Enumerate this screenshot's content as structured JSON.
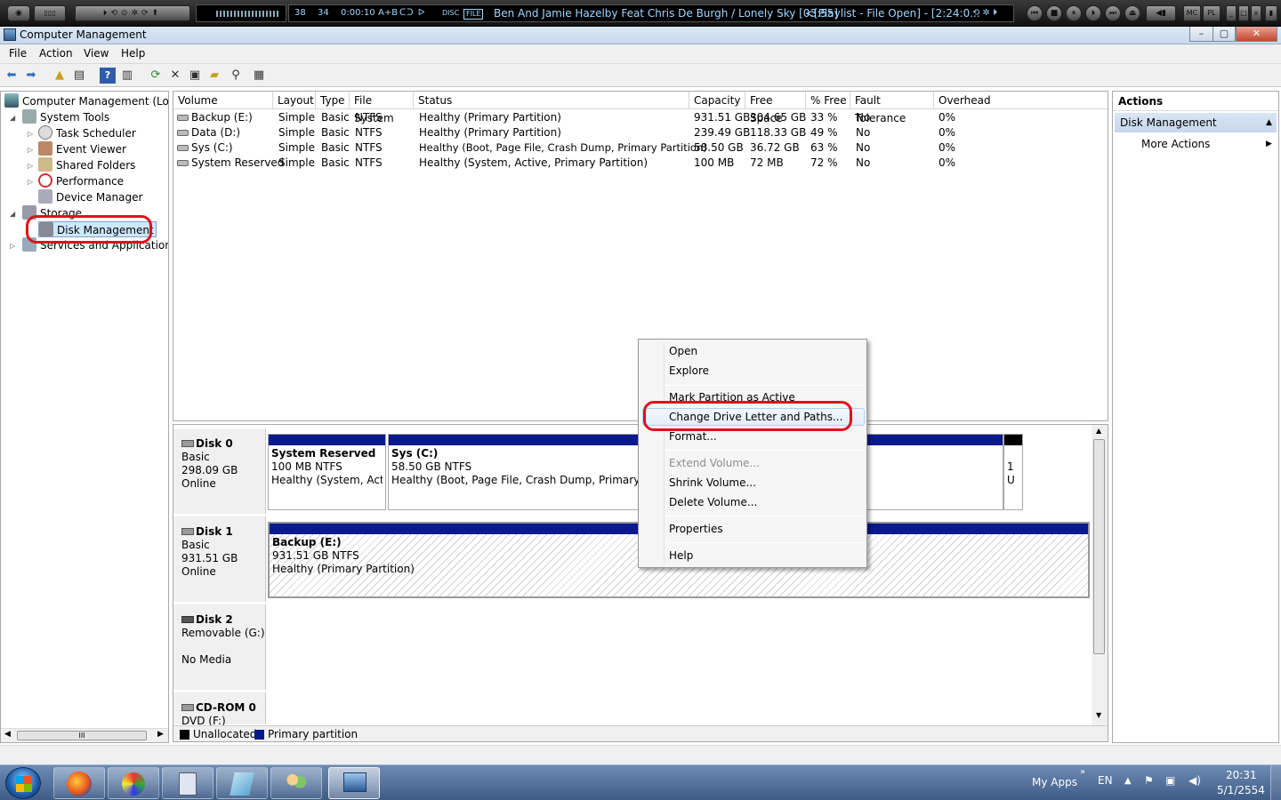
{
  "player": {
    "time_a": "38",
    "time_b": "34",
    "elapsed": "0:00:10",
    "mode_a": "A+B",
    "disc": "DISC",
    "file": "FILE",
    "now_playing": "Ben And Jamie Hazelby Feat Chris De Burgh / Lonely Sky  [03:55]",
    "playlist_status": "<[Playlist - File Open] - [2:24:0...",
    "btn_mc": "MC",
    "btn_pl": "PL"
  },
  "window": {
    "title": "Computer Management",
    "minimize": "–",
    "maximize": "▢",
    "close": "✕"
  },
  "menu": [
    "File",
    "Action",
    "View",
    "Help"
  ],
  "tree": {
    "root": "Computer Management (Local",
    "system_tools": "System Tools",
    "task_scheduler": "Task Scheduler",
    "event_viewer": "Event Viewer",
    "shared_folders": "Shared Folders",
    "performance": "Performance",
    "device_manager": "Device Manager",
    "storage": "Storage",
    "disk_management": "Disk Management",
    "services": "Services and Applications",
    "hscroll_grip": "III"
  },
  "volumes": {
    "headers": [
      "Volume",
      "Layout",
      "Type",
      "File System",
      "Status",
      "Capacity",
      "Free Space",
      "% Free",
      "Fault Tolerance",
      "Overhead"
    ],
    "rows": [
      [
        "Backup (E:)",
        "Simple",
        "Basic",
        "NTFS",
        "Healthy (Primary Partition)",
        "931.51 GB",
        "304.65 GB",
        "33 %",
        "No",
        "0%"
      ],
      [
        "Data (D:)",
        "Simple",
        "Basic",
        "NTFS",
        "Healthy (Primary Partition)",
        "239.49 GB",
        "118.33 GB",
        "49 %",
        "No",
        "0%"
      ],
      [
        "Sys (C:)",
        "Simple",
        "Basic",
        "NTFS",
        "Healthy (Boot, Page File, Crash Dump, Primary Partition)",
        "58.50 GB",
        "36.72 GB",
        "63 %",
        "No",
        "0%"
      ],
      [
        "System Reserved",
        "Simple",
        "Basic",
        "NTFS",
        "Healthy (System, Active, Primary Partition)",
        "100 MB",
        "72 MB",
        "72 %",
        "No",
        "0%"
      ]
    ]
  },
  "disks": {
    "disk0": {
      "name": "Disk 0",
      "type": "Basic",
      "size": "298.09 GB",
      "state": "Online",
      "p1_title": "System Reserved",
      "p1_size": "100 MB NTFS",
      "p1_status": "Healthy (System, Activ",
      "p2_title": "Sys  (C:)",
      "p2_size": "58.50 GB NTFS",
      "p2_status": "Healthy (Boot, Page File, Crash Dump, Primary Partit",
      "p4_line1": "1",
      "p4_line2": "U"
    },
    "disk1": {
      "name": "Disk 1",
      "type": "Basic",
      "size": "931.51 GB",
      "state": "Online",
      "p1_title": "Backup  (E:)",
      "p1_size": "931.51 GB NTFS",
      "p1_status": "Healthy (Primary Partition)"
    },
    "disk2": {
      "name": "Disk 2",
      "type": "Removable (G:)",
      "state": "No Media"
    },
    "cdrom0": {
      "name": "CD-ROM 0",
      "type": "DVD (F:)"
    }
  },
  "legend": {
    "unallocated": "Unallocated",
    "primary": "Primary partition",
    "unallocated_color": "#000000",
    "primary_color": "#0a1a8c"
  },
  "actions": {
    "header": "Actions",
    "section": "Disk Management",
    "more": "More Actions"
  },
  "context_menu": {
    "open": "Open",
    "explore": "Explore",
    "mark_active": "Mark Partition as Active",
    "change_letter": "Change Drive Letter and Paths...",
    "format": "Format...",
    "extend": "Extend Volume...",
    "shrink": "Shrink Volume...",
    "delete": "Delete Volume...",
    "properties": "Properties",
    "help": "Help"
  },
  "taskbar": {
    "my_apps": "My Apps",
    "lang": "EN",
    "time": "20:31",
    "date": "5/1/2554"
  },
  "colors": {
    "highlight": "#e0101a",
    "selection": "#cce8ff",
    "partition_bar": "#0a1a8c"
  }
}
